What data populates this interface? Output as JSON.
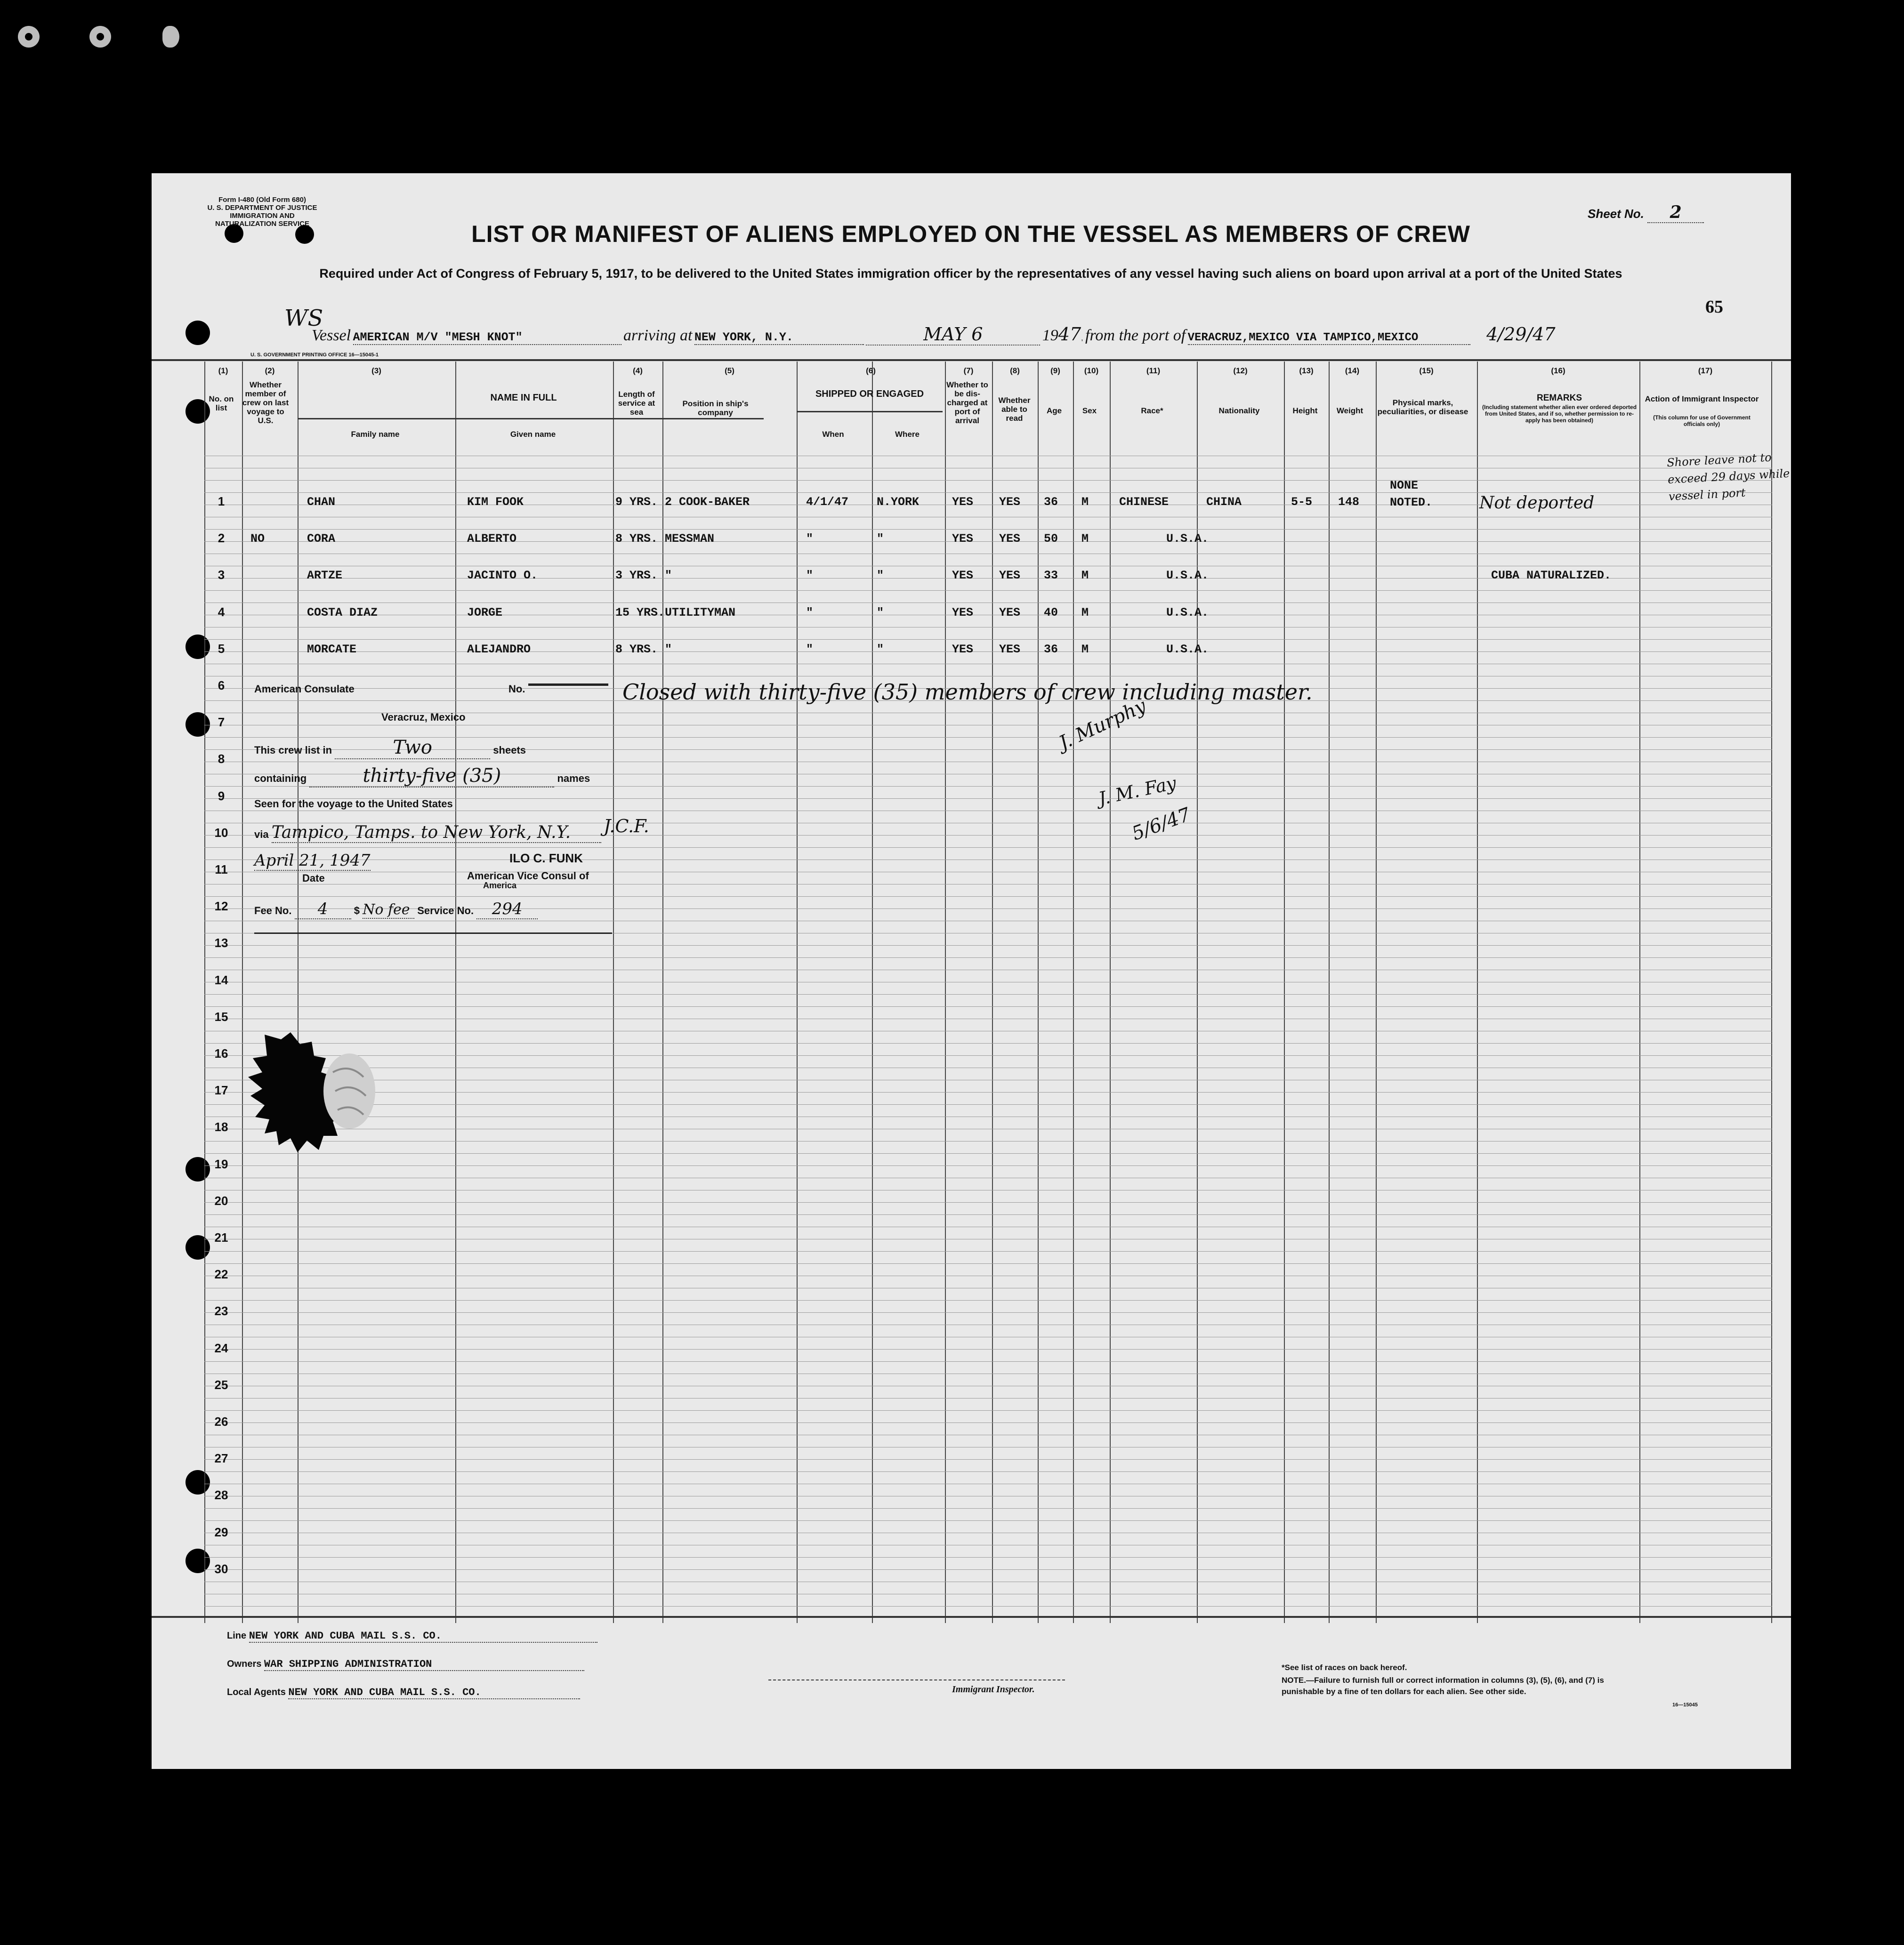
{
  "form": {
    "id_line1": "Form I-480 (Old Form 680)",
    "id_line2": "U. S. DEPARTMENT OF JUSTICE",
    "id_line3": "IMMIGRATION AND NATURALIZATION SERVICE",
    "title": "LIST OR MANIFEST OF ALIENS EMPLOYED ON THE VESSEL AS MEMBERS OF CREW",
    "subtitle": "Required under Act of Congress of February 5, 1917, to be delivered to the United States immigration officer by the representatives of any vessel having such aliens on board upon arrival at a port of the United States",
    "sheet_label": "Sheet No.",
    "sheet_no": "2",
    "page_number": "65",
    "print_code": "U. S. GOVERNMENT PRINTING OFFICE 16—15045-1"
  },
  "voyage": {
    "vessel_label": "Vessel",
    "vessel": "AMERICAN M/V \"MESH KNOT\"",
    "arriving_label": "arriving at",
    "arriving_at": "NEW YORK, N.Y.",
    "month_day": "MAY 6",
    "year_prefix": "19",
    "year": "47",
    "from_label": "from the port of",
    "from_port": "VERACRUZ,MEXICO VIA TAMPICO,MEXICO",
    "date_note": "4/29/47",
    "ws_mark": "WS"
  },
  "columns": {
    "nums": [
      "(1)",
      "(2)",
      "(3)",
      "(4)",
      "(5)",
      "(6)",
      "(7)",
      "(8)",
      "(9)",
      "(10)",
      "(11)",
      "(12)",
      "(13)",
      "(14)",
      "(15)",
      "(16)",
      "(17)"
    ],
    "no_on_list": "No. on list",
    "member_last_voyage": "Whether member of crew on last voyage to U.S.",
    "name_in_full": "NAME IN FULL",
    "family_name": "Family name",
    "given_name": "Given name",
    "length_service": "Length of service at sea",
    "position": "Position in ship's company",
    "shipped": "SHIPPED OR ENGAGED",
    "when": "When",
    "where": "Where",
    "discharged": "Whether to be dis-charged at port of arrival",
    "able_read": "Whether able to read",
    "age": "Age",
    "sex": "Sex",
    "race": "Race*",
    "nationality": "Nationality",
    "height": "Height",
    "weight": "Weight",
    "physical": "Physical marks, peculiarities, or disease",
    "remarks": "REMARKS",
    "remarks_note": "(Including statement whether alien ever ordered deported from United States, and if so, whether permission to re-apply has been obtained)",
    "action": "Action of Immigrant Inspector",
    "action_note": "(This column for use of Government officials only)"
  },
  "crew": [
    {
      "num": "1",
      "member": "",
      "family": "CHAN",
      "given": "KIM FOOK",
      "service": "9 YRS.",
      "position": "2 COOK-BAKER",
      "when": "4/1/47",
      "where": "N.YORK",
      "discharged": "YES",
      "read": "YES",
      "age": "36",
      "sex": "M",
      "race": "CHINESE",
      "nationality": "CHINA",
      "height": "5-5",
      "weight": "148",
      "physical": "NONE NOTED.",
      "remarks": "Not deported",
      "action": "Shore leave not to exceed 29 days while vessel in port"
    },
    {
      "num": "2",
      "member": "NO",
      "family": "CORA",
      "given": "ALBERTO",
      "service": "8 YRS.",
      "position": "MESSMAN",
      "when": "\"",
      "where": "\"",
      "discharged": "YES",
      "read": "YES",
      "age": "50",
      "sex": "M",
      "race": "",
      "nationality": "U.S.A.",
      "height": "",
      "weight": "",
      "physical": "",
      "remarks": "",
      "action": ""
    },
    {
      "num": "3",
      "member": "",
      "family": "ARTZE",
      "given": "JACINTO O.",
      "service": "3 YRS.",
      "position": "\"",
      "when": "\"",
      "where": "\"",
      "discharged": "YES",
      "read": "YES",
      "age": "33",
      "sex": "M",
      "race": "",
      "nationality": "U.S.A.",
      "height": "",
      "weight": "",
      "physical": "",
      "remarks": "CUBA NATURALIZED.",
      "action": ""
    },
    {
      "num": "4",
      "member": "",
      "family": "COSTA DIAZ",
      "given": "JORGE",
      "service": "15 YRS.",
      "position": "UTILITYMAN",
      "when": "\"",
      "where": "\"",
      "discharged": "YES",
      "read": "YES",
      "age": "40",
      "sex": "M",
      "race": "",
      "nationality": "U.S.A.",
      "height": "",
      "weight": "",
      "physical": "",
      "remarks": "",
      "action": ""
    },
    {
      "num": "5",
      "member": "",
      "family": "MORCATE",
      "given": "ALEJANDRO",
      "service": "8 YRS.",
      "position": "\"",
      "when": "\"",
      "where": "\"",
      "discharged": "YES",
      "read": "YES",
      "age": "36",
      "sex": "M",
      "race": "",
      "nationality": "U.S.A.",
      "height": "",
      "weight": "",
      "physical": "",
      "remarks": "",
      "action": ""
    }
  ],
  "row_numbers": [
    "1",
    "2",
    "3",
    "4",
    "5",
    "6",
    "7",
    "8",
    "9",
    "10",
    "11",
    "12",
    "13",
    "14",
    "15",
    "16",
    "17",
    "18",
    "19",
    "20",
    "21",
    "22",
    "23",
    "24",
    "25",
    "26",
    "27",
    "28",
    "29",
    "30"
  ],
  "closing_note": "Closed with thirty-five (35) members of crew including master.",
  "signature": {
    "name": "J. Murphy",
    "initials": "J. M. Fay",
    "date": "5/6/47"
  },
  "consulate": {
    "heading": "American Consulate",
    "no_label": "No.",
    "location": "Veracruz, Mexico",
    "line1_a": "This crew list in",
    "line1_val": "Two",
    "line1_b": "sheets",
    "line2_a": "containing",
    "line2_val": "thirty-five (35)",
    "line2_b": "names",
    "line3": "Seen for the voyage to the United States",
    "line4_a": "via",
    "line4_val": "Tampico, Tamps. to New York, N.Y.",
    "date_val": "April 21, 1947",
    "date_label": "Date",
    "officer": "ILO C. FUNK",
    "officer_title": "American Vice Consul of",
    "officer_title2": "America",
    "fee_label": "Fee No.",
    "fee_no": "4",
    "dollar": "$",
    "fee_amount": "No fee",
    "service_label": "Service No.",
    "service_no": "294"
  },
  "footer": {
    "line_label": "Line",
    "line_val": "NEW YORK AND CUBA MAIL S.S. CO.",
    "owners_label": "Owners",
    "owners_val": "WAR SHIPPING ADMINISTRATION",
    "agents_label": "Local Agents",
    "agents_val": "NEW YORK AND CUBA MAIL S.S. CO.",
    "inspector_label": "Immigrant Inspector.",
    "races_note": "*See list of races on back hereof.",
    "note": "NOTE.—Failure to furnish full or correct information in columns (3), (5), (6), and (7) is punishable by a fine of ten dollars for each alien. See other side.",
    "code": "16—15045"
  }
}
